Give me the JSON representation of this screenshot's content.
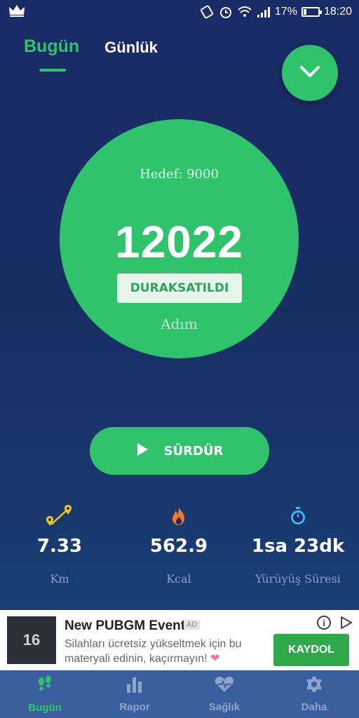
{
  "status_bar": {
    "battery": "17%",
    "time": "18:20",
    "battery_level": 0.17
  },
  "tabs": [
    {
      "label": "Bugün",
      "active": true
    },
    {
      "label": "Günlük",
      "active": false
    }
  ],
  "main": {
    "goal": "Hedef: 9000",
    "steps": "12022",
    "status": "DURAKSATILDI",
    "unit": "Adım",
    "resume_label": "SÜRDÜR"
  },
  "stats": [
    {
      "icon": "map-pins-icon",
      "value": "7.33",
      "label": "Km"
    },
    {
      "icon": "flame-icon",
      "value": "562.9",
      "label": "Kcal"
    },
    {
      "icon": "stopwatch-icon",
      "value": "1sa 23dk",
      "label": "Yürüyüş Süresi"
    }
  ],
  "ad": {
    "thumb_text": "16",
    "title": "New PUBGM Event",
    "badge": "AD",
    "text": "Silahları ücretsiz yükseltmek için bu materyali edinin, kaçırmayın!",
    "heart": "❤",
    "cta": "KAYDOL",
    "info": "i"
  },
  "nav": [
    {
      "label": "Bugün",
      "icon": "footsteps-icon",
      "active": true
    },
    {
      "label": "Rapor",
      "icon": "bar-chart-icon",
      "active": false
    },
    {
      "label": "Sağlık",
      "icon": "heart-pulse-icon",
      "active": false
    },
    {
      "label": "Daha",
      "icon": "gear-icon",
      "active": false
    }
  ],
  "colors": {
    "accent": "#2fc36b",
    "background": "#1a2c68",
    "nav": "#3a5f9c"
  }
}
